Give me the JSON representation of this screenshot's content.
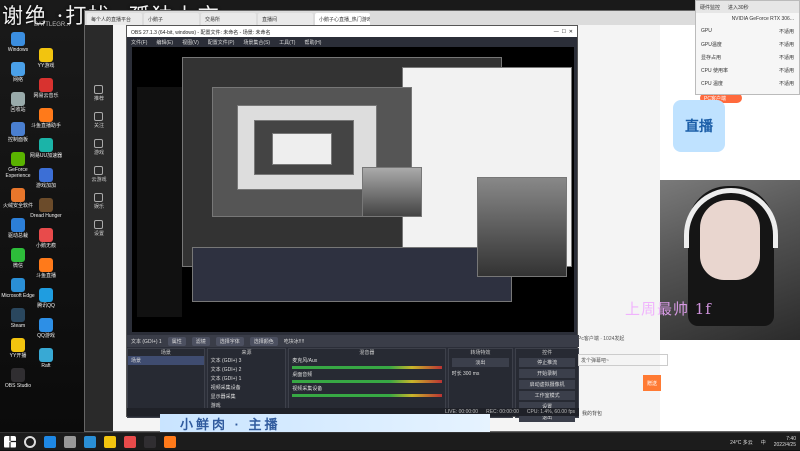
{
  "wallpaper": {
    "title": "谢绝 ·打扰 ·孤独上市",
    "sub": "BATTLEGR..."
  },
  "desktop_icons_left": [
    {
      "label": "Windows",
      "color": "#3b8ee0"
    },
    {
      "label": "网络",
      "color": "#4aa0e8"
    },
    {
      "label": "回收站",
      "color": "#9aa"
    },
    {
      "label": "控制面板",
      "color": "#4a7fd0"
    },
    {
      "label": "GeForce Experience",
      "color": "#5ab300"
    },
    {
      "label": "火绒安全软件",
      "color": "#e8762b"
    },
    {
      "label": "驱动总裁",
      "color": "#2c7fd8"
    },
    {
      "label": "微信",
      "color": "#2dbd3a"
    },
    {
      "label": "Microsoft Edge",
      "color": "#2a8fd6"
    },
    {
      "label": "Steam",
      "color": "#2a475e"
    },
    {
      "label": "YY开播",
      "color": "#f2c40f"
    },
    {
      "label": "OBS Studio",
      "color": "#302e31"
    }
  ],
  "desktop_icons_mid": [
    {
      "label": "YY游戏",
      "color": "#f2c40f"
    },
    {
      "label": "网易云音乐",
      "color": "#d8322f"
    },
    {
      "label": "斗鱼直播助手",
      "color": "#ff7a1a"
    },
    {
      "label": "网易UU加速器",
      "color": "#1bb4a8"
    },
    {
      "label": "游戏加加",
      "color": "#3c6fd6"
    },
    {
      "label": "Dread Hunger",
      "color": "#6b4b2a"
    },
    {
      "label": "小鹅无痕",
      "color": "#e84b4b"
    },
    {
      "label": "斗鱼直播",
      "color": "#ff7a1a"
    },
    {
      "label": "腾讯QQ",
      "color": "#1f9de0"
    },
    {
      "label": "QQ游戏",
      "color": "#2d8fe6"
    },
    {
      "label": "Raft",
      "color": "#38a9d4"
    }
  ],
  "browser": {
    "tabs": [
      "每个人的直播平台",
      "小鹅子",
      "交易所",
      "直播间",
      "小鹅子心直播_热门游戏直"
    ],
    "side_items": [
      "推荐",
      "关注",
      "游戏",
      "云游戏",
      "娱乐",
      "设置"
    ],
    "pc_badge": "PC客户端",
    "ad_text": "直播"
  },
  "hw_monitor": {
    "tabs": [
      "硬件监控",
      "进入30秒"
    ],
    "gpu_name": "NVIDIA GeForce RTX 306...",
    "rows": [
      {
        "k": "GPU",
        "v": "不适用"
      },
      {
        "k": "GPU温度",
        "v": "不适用"
      },
      {
        "k": "显存占用",
        "v": "不适用"
      },
      {
        "k": "CPU 使用率",
        "v": "不适用"
      },
      {
        "k": "CPU 温度",
        "v": "不适用"
      }
    ]
  },
  "obs": {
    "title": "OBS 27.1.3 (64-bit, windows) - 配置文件: 未命名 - 场景: 未命名",
    "menu": [
      "文件(F)",
      "编辑(E)",
      "视图(V)",
      "配置文件(P)",
      "场景集合(S)",
      "工具(T)",
      "帮助(H)"
    ],
    "source_bar": {
      "source": "文本 (GDI+) 1",
      "props": "属性",
      "filters": "滤镜",
      "select_text": "选择字体",
      "select_file": "选择颜色",
      "text_val": "吃块冰!!!!"
    },
    "docks": {
      "scenes": {
        "title": "场景",
        "items": [
          "场景"
        ]
      },
      "sources": {
        "title": "来源",
        "items": [
          "文本 (GDI+) 3",
          "文本 (GDI+) 2",
          "文本 (GDI+) 1",
          "视频采集设备",
          "显示器采集",
          "游戏"
        ]
      },
      "mixer": {
        "title": "混音器",
        "channels": [
          "麦克风/Aux",
          "桌面音频",
          "视频采集设备"
        ]
      },
      "transitions": {
        "title": "转场特效",
        "type": "淡出",
        "duration_label": "时长",
        "duration": "300 ms"
      },
      "controls": {
        "title": "控件",
        "buttons": [
          "停止推流",
          "开始录制",
          "启动虚拟摄像机",
          "工作室模式",
          "设置",
          "退出"
        ]
      }
    },
    "status": {
      "live": "LIVE: 00:00:00",
      "rec": "REC: 00:00:00",
      "cpu": "CPU: 1.4%, 60.00 fps"
    }
  },
  "overlay_text": "上周最帅 1f",
  "banner_text": "小鲜肉 · 主播",
  "chat": {
    "line1": "Pc客户端 · 1024发起",
    "placeholder": "发个弹幕吧~",
    "gift": "赠送",
    "my_gift": "我的背包"
  },
  "taskbar": {
    "temp": "24°C 多云",
    "ime": "中",
    "time": "7:40",
    "date": "2022/4/25",
    "apps": [
      "#1e88e5",
      "#999",
      "#2a8fd6",
      "#f2c40f",
      "#e84b4b",
      "#302e31",
      "#ff7a1a"
    ]
  }
}
